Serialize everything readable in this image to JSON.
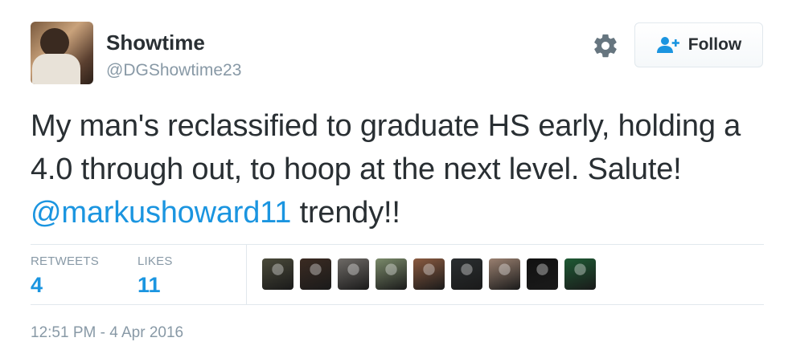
{
  "user": {
    "display_name": "Showtime",
    "handle": "@DGShowtime23"
  },
  "follow_button": {
    "label": "Follow"
  },
  "tweet": {
    "text_parts": [
      "My man's reclassified to graduate HS early, holding a 4.0 through out, to hoop at the next level. Salute! ",
      "@markushoward11",
      " trendy!!"
    ]
  },
  "stats": {
    "retweets_label": "RETWEETS",
    "retweets_value": "4",
    "likes_label": "LIKES",
    "likes_value": "11"
  },
  "likers": [
    {
      "name": "liker-avatar-1",
      "color": "#4a4a3a"
    },
    {
      "name": "liker-avatar-2",
      "color": "#3b2b22"
    },
    {
      "name": "liker-avatar-3",
      "color": "#6e6a66"
    },
    {
      "name": "liker-avatar-4",
      "color": "#7a8a6a"
    },
    {
      "name": "liker-avatar-5",
      "color": "#8a5a40"
    },
    {
      "name": "liker-avatar-6",
      "color": "#2a2e30"
    },
    {
      "name": "liker-avatar-7",
      "color": "#9a8070"
    },
    {
      "name": "liker-avatar-8",
      "color": "#111111"
    },
    {
      "name": "liker-avatar-9",
      "color": "#1e5a34"
    }
  ],
  "timestamp": "12:51 PM - 4 Apr 2016",
  "colors": {
    "accent": "#1b95e0",
    "muted": "#8899a6",
    "text": "#292f33",
    "border": "#e1e8ed"
  },
  "icons": {
    "settings": "gear-icon",
    "follow": "add-user-icon"
  }
}
